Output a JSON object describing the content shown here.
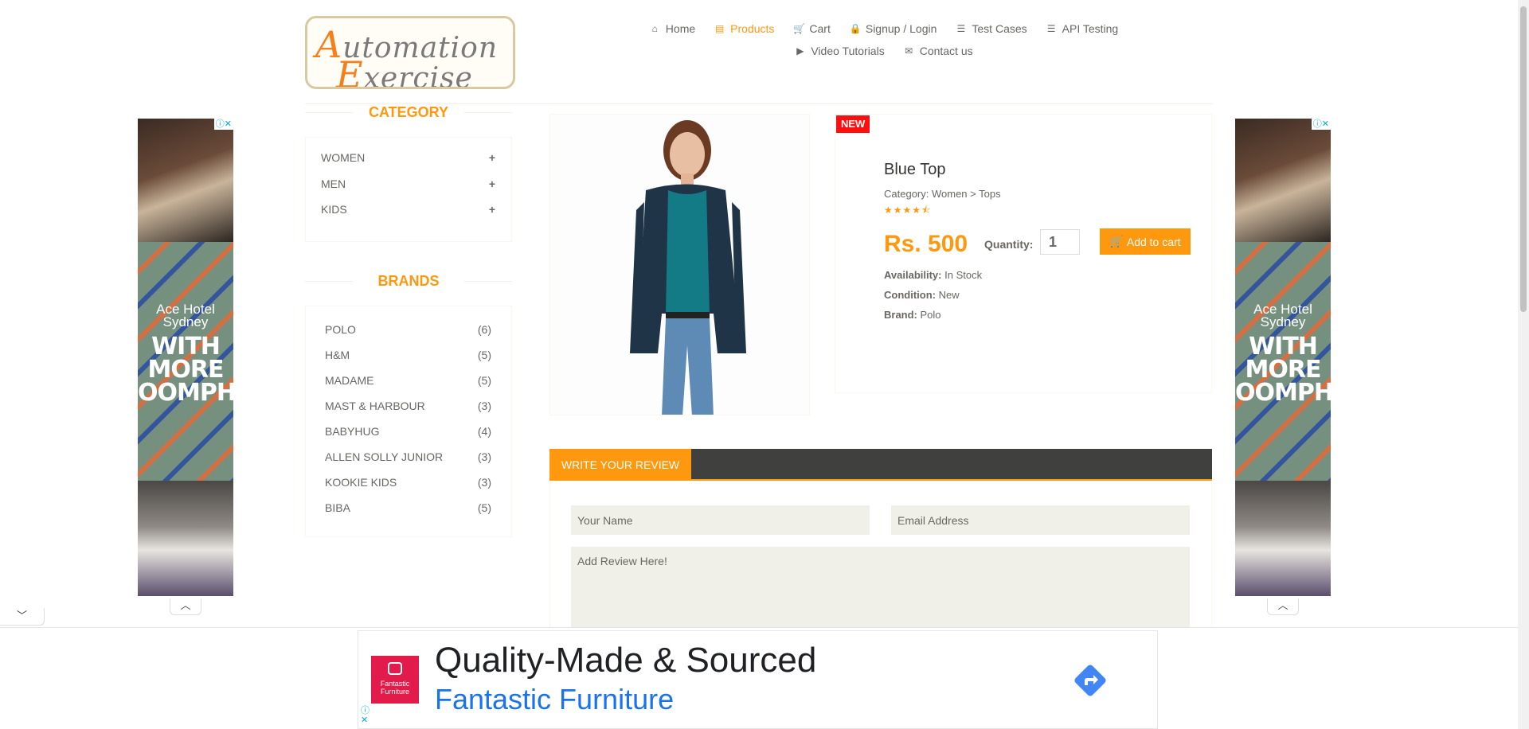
{
  "logo": {
    "line1_cap": "A",
    "line1_rest": "utomation",
    "line2_cap": "E",
    "line2_rest": "xercise"
  },
  "nav": {
    "row1": [
      {
        "icon": "⌂",
        "label": "Home"
      },
      {
        "icon": "▤",
        "label": "Products",
        "active": true
      },
      {
        "icon": "🛒",
        "label": "Cart"
      },
      {
        "icon": "🔒",
        "label": "Signup / Login"
      },
      {
        "icon": "☰",
        "label": "Test Cases"
      },
      {
        "icon": "☰",
        "label": "API Testing"
      }
    ],
    "row2": [
      {
        "icon": "▶",
        "label": "Video Tutorials"
      },
      {
        "icon": "✉",
        "label": "Contact us"
      }
    ]
  },
  "sidebar": {
    "category_title": "CATEGORY",
    "categories": [
      "WOMEN",
      "MEN",
      "KIDS"
    ],
    "brands_title": "BRANDS",
    "brands": [
      {
        "name": "POLO",
        "count": "(6)"
      },
      {
        "name": "H&M",
        "count": "(5)"
      },
      {
        "name": "MADAME",
        "count": "(5)"
      },
      {
        "name": "MAST & HARBOUR",
        "count": "(3)"
      },
      {
        "name": "BABYHUG",
        "count": "(4)"
      },
      {
        "name": "ALLEN SOLLY JUNIOR",
        "count": "(3)"
      },
      {
        "name": "KOOKIE KIDS",
        "count": "(3)"
      },
      {
        "name": "BIBA",
        "count": "(5)"
      }
    ]
  },
  "product": {
    "badge": "NEW",
    "name": "Blue Top",
    "category": "Category: Women > Tops",
    "rating": 4.5,
    "price": "Rs. 500",
    "quantity_label": "Quantity:",
    "quantity": "1",
    "add_to_cart": "Add to cart",
    "availability_label": "Availability:",
    "availability": "In Stock",
    "condition_label": "Condition:",
    "condition": "New",
    "brand_label": "Brand:",
    "brand": "Polo"
  },
  "review": {
    "tab": "WRITE YOUR REVIEW",
    "name_placeholder": "Your Name",
    "email_placeholder": "Email Address",
    "review_placeholder": "Add Review Here!"
  },
  "side_ad": {
    "line1": "Ace Hotel",
    "line2": "Sydney",
    "big1": "WITH",
    "big2": "MORE",
    "big3": "OOMPH"
  },
  "bottom_ad": {
    "brand": "Fantastic Furniture",
    "headline": "Quality-Made & Sourced",
    "subline": "Fantastic Furniture"
  },
  "colors": {
    "accent": "#fe980f",
    "badge": "#fe0f0f",
    "dark_bar": "#40403e",
    "link_blue": "#1a73e8"
  }
}
